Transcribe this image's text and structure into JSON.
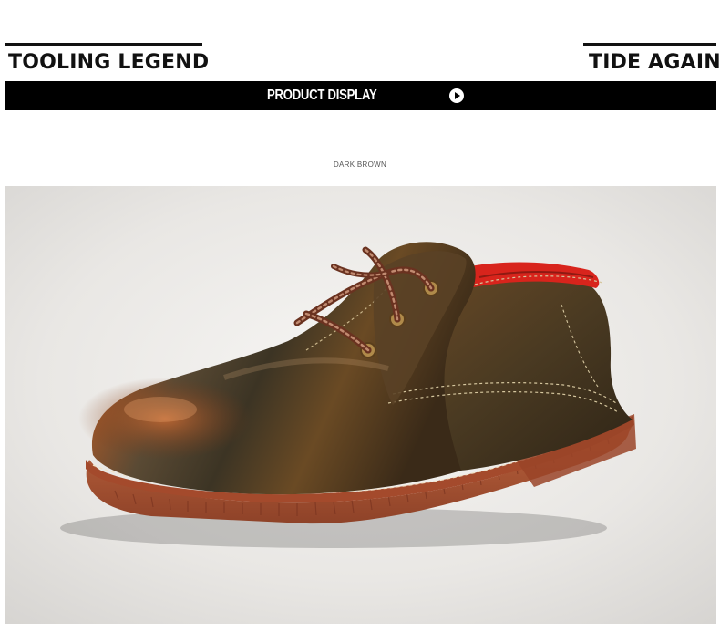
{
  "header": {
    "left_title": "TOOLING LEGEND",
    "right_title": "TIDE AGAIN",
    "banner_label": "PRODUCT DISPLAY",
    "play_icon": "play-circle-icon"
  },
  "product": {
    "color_name": "DARK BROWN",
    "image_subject": "brown leather derby shoe"
  },
  "colors": {
    "bar": "#000000",
    "leather_dark": "#3b2a16",
    "leather_brown": "#8a4e22",
    "sole": "#b35a3a",
    "lining": "#d8241c",
    "eyelet": "#b08a4a"
  }
}
